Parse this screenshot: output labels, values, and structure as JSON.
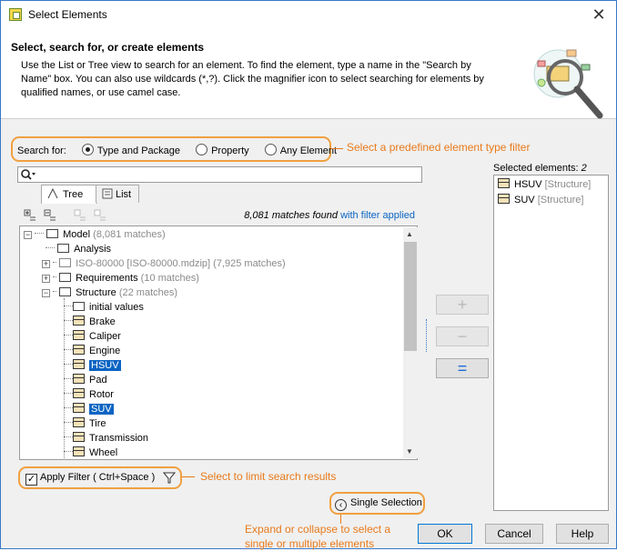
{
  "window": {
    "title": "Select Elements",
    "close_glyph": "✕"
  },
  "header": {
    "heading": "Select, search for, or create elements",
    "description": "Use the List or Tree view to search for an element. To find the element, type a name in the \"Search by Name\" box. You can also use wildcards (*,?). Click the magnifier icon to select searching for elements by qualified names, or use camel case."
  },
  "search_for": {
    "label": "Search for:",
    "options": [
      "Type and Package",
      "Property",
      "Any Element"
    ],
    "selected": "Type and Package"
  },
  "annotations": {
    "filter_type": "Select a predefined element type filter",
    "limit_results": "Select to limit search results",
    "expand_line1": "Expand or collapse to select a",
    "expand_line2": "single or multiple elements"
  },
  "search_box": {
    "value": "",
    "icon": "magnifier-icon"
  },
  "tabs": {
    "tree": "Tree",
    "list": "List",
    "active": "Tree"
  },
  "match_info": {
    "count_text": "8,081 matches found",
    "filter_text": "with filter applied"
  },
  "tree": {
    "rows": [
      {
        "label": "Model",
        "extra": "(8,081 matches)",
        "kind": "model",
        "expander": "−"
      },
      {
        "label": "Analysis",
        "extra": "",
        "kind": "folder",
        "expander": ""
      },
      {
        "label": "ISO-80000 [ISO-80000.mdzip]",
        "extra": "(7,925 matches)",
        "kind": "package-gray",
        "expander": "+"
      },
      {
        "label": "Requirements",
        "extra": "(10 matches)",
        "kind": "folder",
        "expander": "+"
      },
      {
        "label": "Structure",
        "extra": "(22 matches)",
        "kind": "folder",
        "expander": "−"
      },
      {
        "label": "initial values",
        "extra": "",
        "kind": "folder",
        "expander": ""
      },
      {
        "label": "Brake",
        "extra": "",
        "kind": "class",
        "expander": ""
      },
      {
        "label": "Caliper",
        "extra": "",
        "kind": "class",
        "expander": ""
      },
      {
        "label": "Engine",
        "extra": "",
        "kind": "class",
        "expander": ""
      },
      {
        "label": "HSUV",
        "extra": "",
        "kind": "class",
        "expander": "",
        "selected": true
      },
      {
        "label": "Pad",
        "extra": "",
        "kind": "class",
        "expander": ""
      },
      {
        "label": "Rotor",
        "extra": "",
        "kind": "class",
        "expander": ""
      },
      {
        "label": "SUV",
        "extra": "",
        "kind": "class",
        "expander": "",
        "selected": true
      },
      {
        "label": "Tire",
        "extra": "",
        "kind": "class",
        "expander": ""
      },
      {
        "label": "Transmission",
        "extra": "",
        "kind": "class",
        "expander": ""
      },
      {
        "label": "Wheel",
        "extra": "",
        "kind": "class",
        "expander": ""
      }
    ]
  },
  "apply_filter": {
    "label": "Apply Filter ( Ctrl+Space )",
    "checked": true,
    "icon": "funnel-icon"
  },
  "single_selection": {
    "label": "Single Selection",
    "icon": "chevron-left-icon"
  },
  "transfer_buttons": {
    "add": "+",
    "remove": "−",
    "remove_all": "="
  },
  "selected_elements": {
    "label": "Selected elements: ",
    "count": "2",
    "items": [
      {
        "name": "HSUV",
        "type": "[Structure]"
      },
      {
        "name": "SUV",
        "type": "[Structure]"
      }
    ]
  },
  "footer": {
    "ok": "OK",
    "cancel": "Cancel",
    "help": "Help"
  },
  "colors": {
    "accent": "#0a64c2",
    "annotation": "#e87a1b",
    "frame": "#f0a040"
  }
}
